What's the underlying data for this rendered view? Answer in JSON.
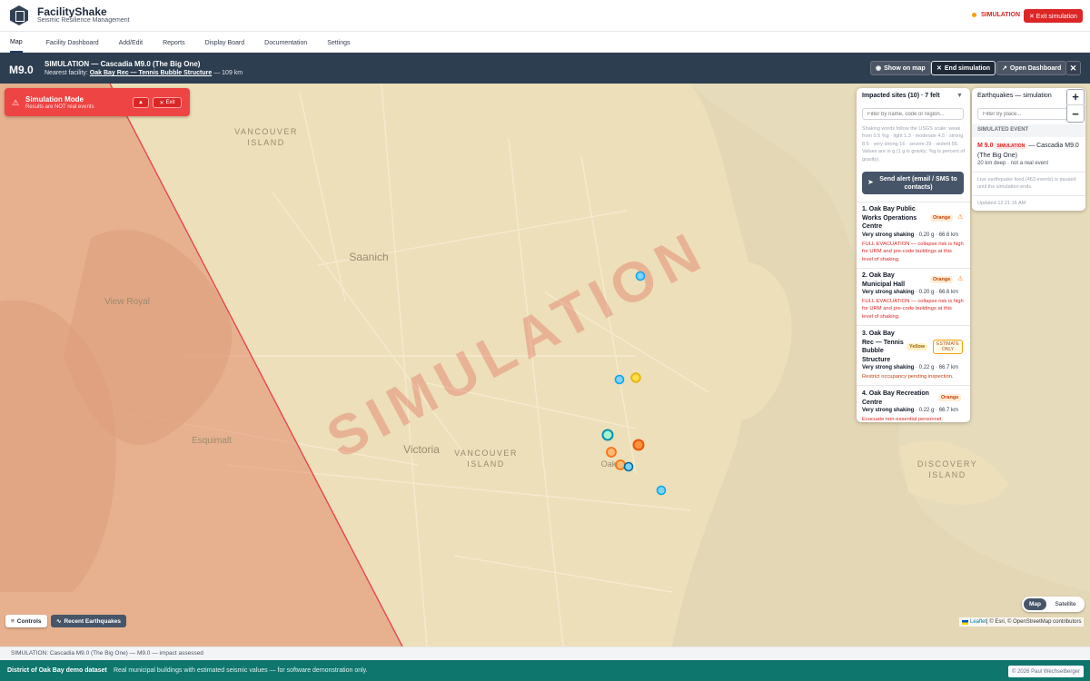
{
  "app": {
    "name": "FacilityShake",
    "tagline": "Seismic Resilience Management"
  },
  "header": {
    "sim_indicator": "SIMULATION",
    "exit_label": "✕ Exit simulation"
  },
  "nav": {
    "items": [
      "Map",
      "Facility Dashboard",
      "Add/Edit",
      "Reports",
      "Display Board",
      "Documentation",
      "Settings"
    ],
    "active": "Map"
  },
  "simbar": {
    "magnitude": "M9.0",
    "title": "SIMULATION — Cascadia M9.0 (The Big One)",
    "nearest_prefix": "Nearest facility: ",
    "nearest_name": "Oak Bay Rec — Tennis Bubble Structure",
    "nearest_suffix": " — 109 km",
    "show_on_map": "Show on map",
    "end_simulation": "End simulation",
    "open_dashboard": "Open Dashboard",
    "close": "✕"
  },
  "sim_mode_card": {
    "title": "Simulation Mode",
    "subtitle": "Results are NOT real events",
    "exit": "Exit"
  },
  "map": {
    "watermark": "SIMULATION",
    "places": [
      "VANCOUVER",
      "ISLAND",
      "Saanich",
      "View Royal",
      "Esquimalt",
      "Victoria",
      "VANCOUVER",
      "ISLAND",
      "DISCOVERY",
      "ISLAND",
      "Oak"
    ]
  },
  "impacted": {
    "header": "Impacted sites (10) · 7 felt",
    "search_placeholder": "Filter by name, code or region...",
    "note": "Shaking words follow the USGS scale: weak from 0.5 %g · light 1.3 · moderate 4.5 · strong 8.5 · very strong 16 · severe 29 · violent 55. Values are in g (1 g is gravity; %g is percent of gravity).",
    "alert_button": "Send alert (email / SMS to contacts)",
    "sites": [
      {
        "name": "1. Oak Bay Public Works Operations Centre",
        "level": "Orange",
        "shake_label": "Very strong shaking",
        "shake_values": " · 0.20 g · 66.6 km",
        "action": "FULL EVACUATION — collapse risk is high for URM and pre-code buildings at this level of shaking."
      },
      {
        "name": "2. Oak Bay Municipal Hall",
        "level": "Orange",
        "shake_label": "Very strong shaking",
        "shake_values": " · 0.20 g · 66.6 km",
        "action": "FULL EVACUATION — collapse risk is high for URM and pre-code buildings at this level of shaking."
      },
      {
        "name": "3. Oak Bay Rec — Tennis Bubble Structure",
        "level": "Yellow",
        "estimate": "ESTIMATE ONLY",
        "shake_label": "Very strong shaking",
        "shake_values": " · 0.22 g · 66.7 km",
        "action": "Restrict occupancy pending inspection."
      },
      {
        "name": "4. Oak Bay Recreation Centre",
        "level": "Orange",
        "shake_label": "Very strong shaking",
        "shake_values": " · 0.22 g · 66.7 km",
        "action": "Evacuate non-essential personnel."
      }
    ]
  },
  "earthquakes": {
    "header": "Earthquakes — simulation",
    "search_placeholder": "Filter by place...",
    "simulated_label": "SIMULATED EVENT",
    "event_mag": "M 9.0",
    "event_tag": "SIMULATION",
    "event_title": " — Cascadia M9.0 (The Big One)",
    "event_sub": "20 km deep · not a real event",
    "paused_note": "Live earthquake feed (463 events) is paused until the simulation ends.",
    "updated": "Updated 12:21:16 AM"
  },
  "zoom": {
    "in": "+",
    "out": "−"
  },
  "map_controls": {
    "controls": "Controls",
    "recent": "Recent Earthquakes",
    "layer_map": "Map",
    "layer_satellite": "Satellite"
  },
  "attribution": {
    "leaflet": "Leaflet",
    "rest": " | © Esri, © OpenStreetMap contributors"
  },
  "status_text": "SIMULATION: Cascadia M9.0 (The Big One) — M9.0 — impact assessed",
  "footer": {
    "dataset": "District of Oak Bay demo dataset",
    "desc": "Real municipal buildings with estimated seismic values — for software demonstration only.",
    "copyright": "© 2026 Paul Wechselberger"
  },
  "colors": {
    "accent_red": "#dc2626",
    "simbar": "#2d3e50",
    "footer": "#0f766e",
    "orange_marker": "#f97316",
    "yellow_marker": "#eab308",
    "blue_marker": "#38bdf8"
  }
}
